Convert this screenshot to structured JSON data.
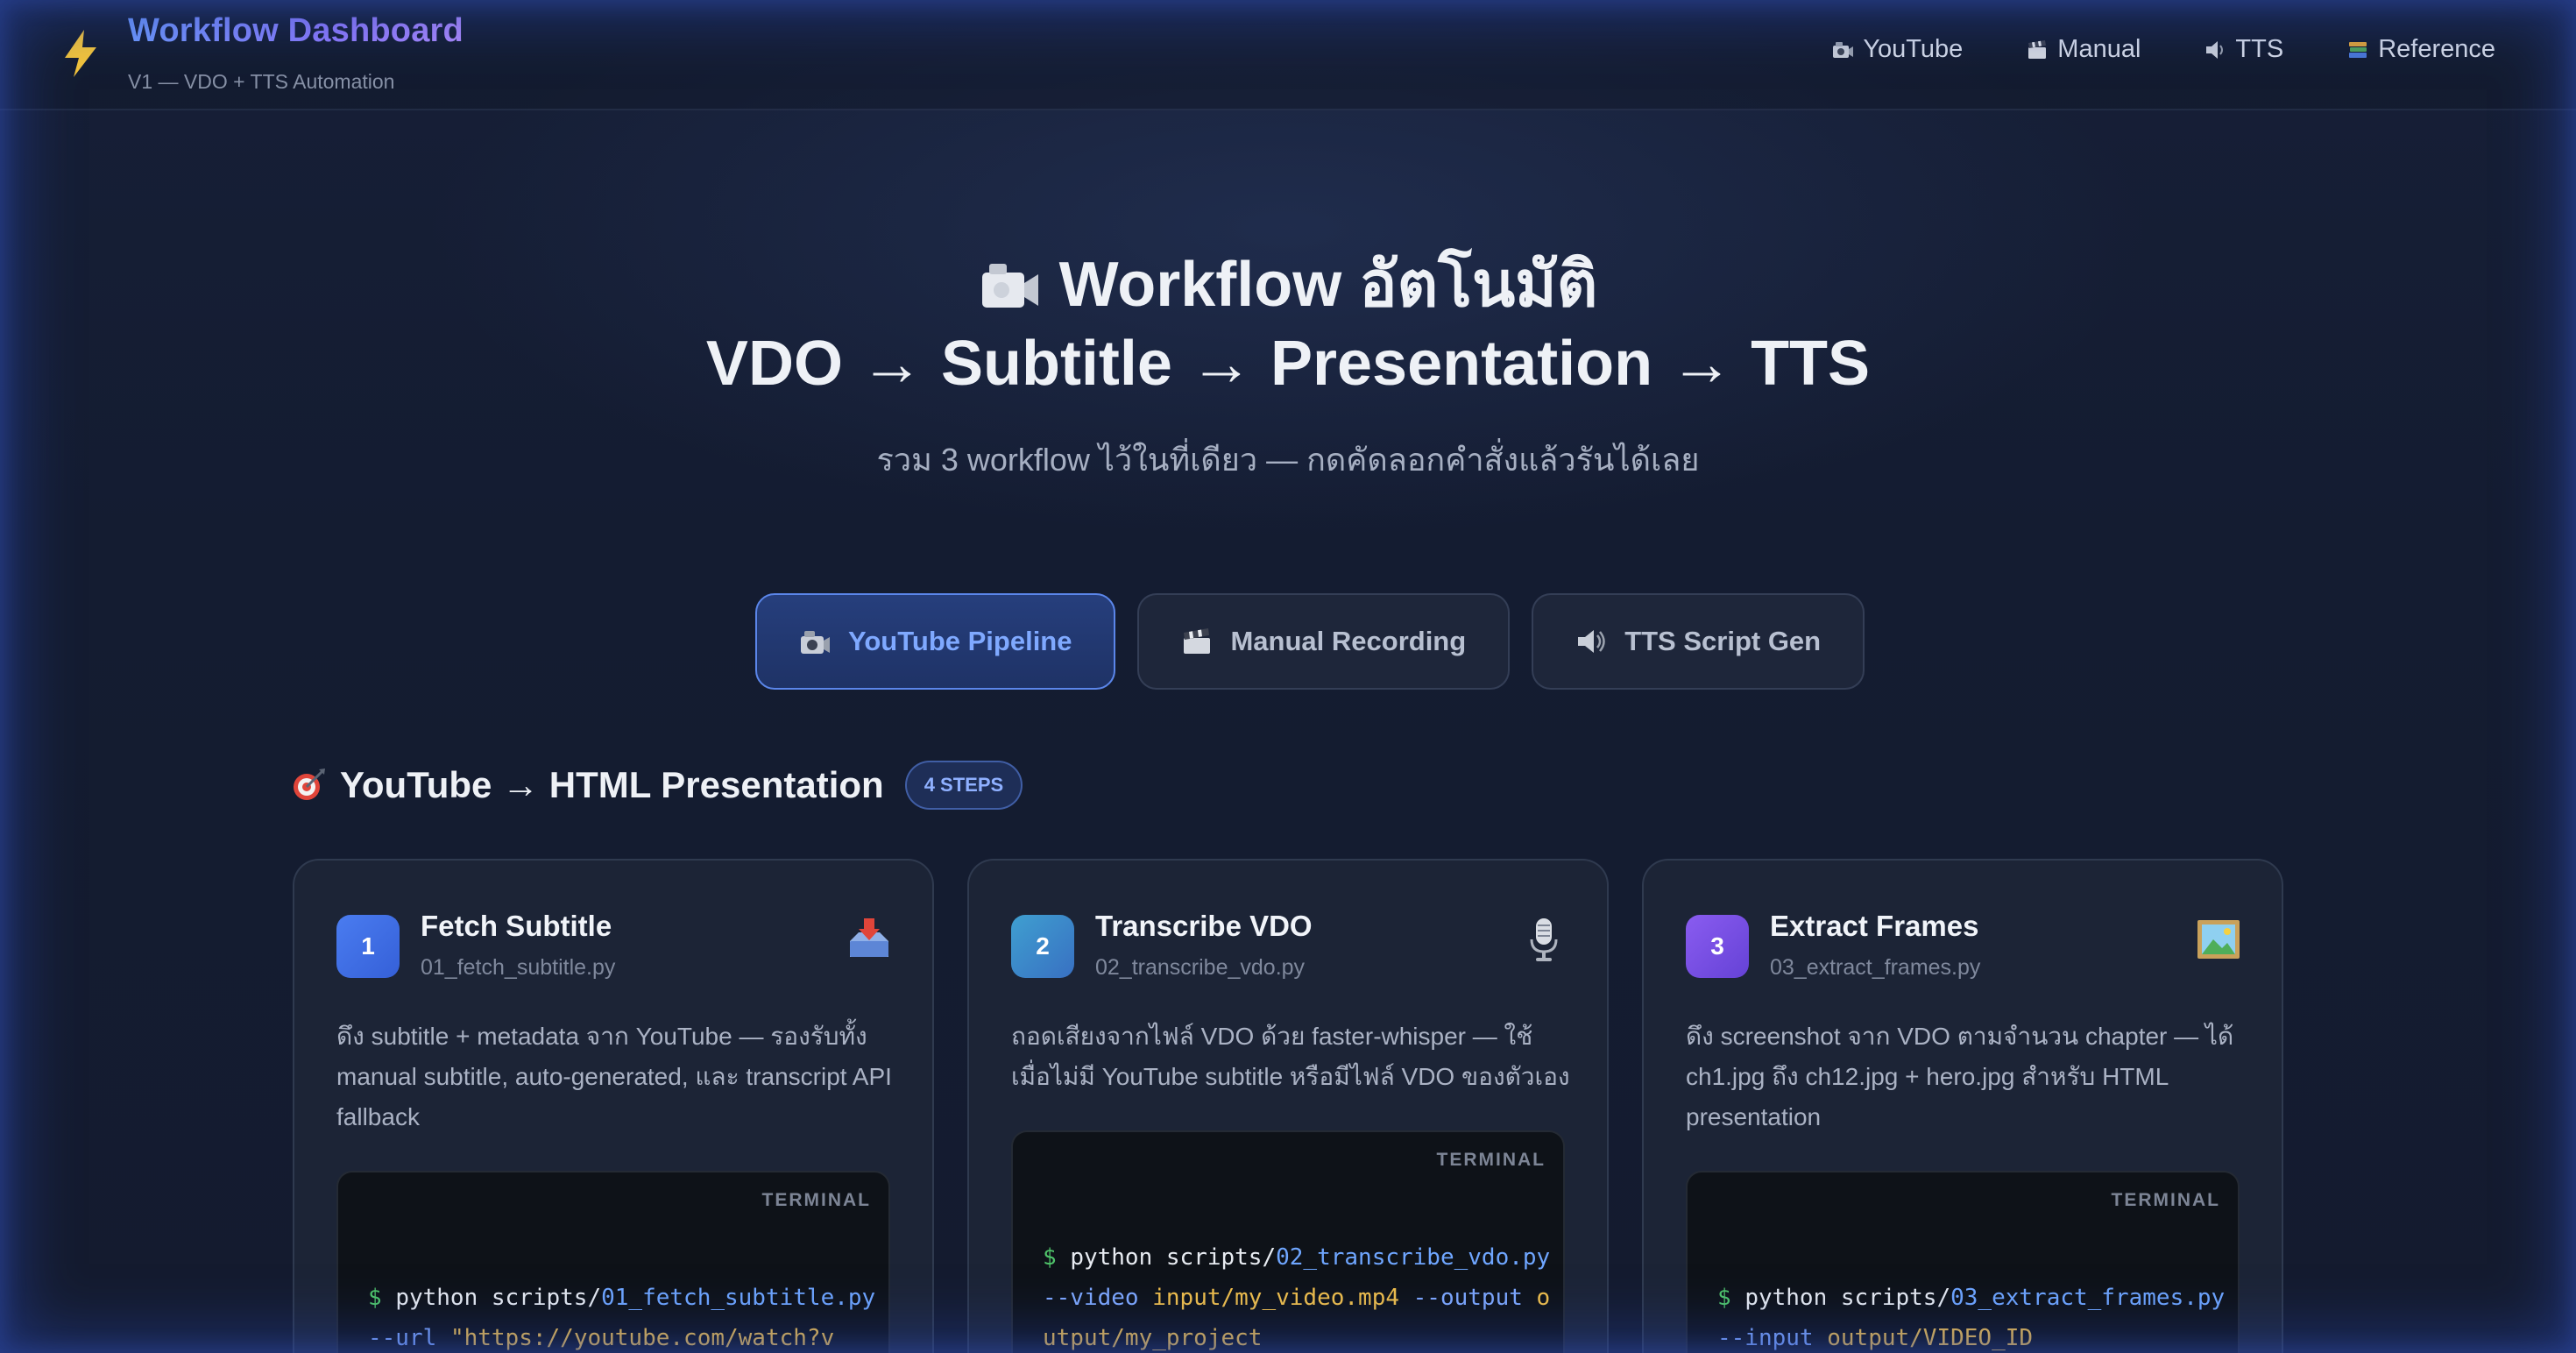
{
  "brand": {
    "title": "Workflow Dashboard",
    "subtitle": "V1 — VDO + TTS Automation",
    "icon": "lightning-icon"
  },
  "nav": [
    {
      "label": "YouTube",
      "icon": "camera-icon"
    },
    {
      "label": "Manual",
      "icon": "clapper-icon"
    },
    {
      "label": "TTS",
      "icon": "speaker-icon"
    },
    {
      "label": "Reference",
      "icon": "books-icon"
    }
  ],
  "hero": {
    "title_line1": "Workflow อัตโนมัติ",
    "title_line2": "VDO → Subtitle → Presentation → TTS",
    "subtitle": "รวม 3 workflow ไว้ในที่เดียว — กดคัดลอกคำสั่งแล้วรันได้เลย"
  },
  "tabs": [
    {
      "label": "YouTube Pipeline",
      "active": true,
      "icon": "camera-icon"
    },
    {
      "label": "Manual Recording",
      "active": false,
      "icon": "clapper-icon"
    },
    {
      "label": "TTS Script Gen",
      "active": false,
      "icon": "speaker-icon"
    }
  ],
  "section": {
    "title": "YouTube → HTML Presentation",
    "badge": "4 STEPS",
    "icon": "target-icon"
  },
  "cards": [
    {
      "num": "1",
      "title": "Fetch Subtitle",
      "file": "01_fetch_subtitle.py",
      "icon": "inbox-tray-icon",
      "desc": "ดึง subtitle + metadata จาก YouTube — รองรับทั้ง manual subtitle, auto-generated, และ transcript API fallback",
      "terminal_label": "TERMINAL",
      "cmd_prompt": "$",
      "cmd_prefix": "python scripts/",
      "cmd_script": "01_fetch_subtitle.py",
      "cmd_flag1": "--url",
      "cmd_arg1": "\"https://youtube.com/watch?v"
    },
    {
      "num": "2",
      "title": "Transcribe VDO",
      "file": "02_transcribe_vdo.py",
      "icon": "microphone-icon",
      "desc": "ถอดเสียงจากไฟล์ VDO ด้วย faster-whisper — ใช้เมื่อไม่มี YouTube subtitle หรือมีไฟล์ VDO ของตัวเอง",
      "terminal_label": "TERMINAL",
      "cmd_prompt": "$",
      "cmd_prefix": "python scripts/",
      "cmd_script": "02_transcribe_vdo.py",
      "cmd_flag1": "--video",
      "cmd_arg1": "input/my_video.mp4",
      "cmd_flag2": "--output",
      "cmd_arg2": "output/my_project"
    },
    {
      "num": "3",
      "title": "Extract Frames",
      "file": "03_extract_frames.py",
      "icon": "framed-picture-icon",
      "desc": "ดึง screenshot จาก VDO ตามจำนวน chapter — ได้ ch1.jpg ถึง ch12.jpg + hero.jpg สำหรับ HTML presentation",
      "terminal_label": "TERMINAL",
      "cmd_prompt": "$",
      "cmd_prefix": "python scripts/",
      "cmd_script": "03_extract_frames.py",
      "cmd_flag1": "--input",
      "cmd_arg1": "output/VIDEO_ID"
    }
  ],
  "colors": {
    "accent": "#7fa9ff",
    "step1": "#3f6fe6",
    "step2": "#3a86c8",
    "step3": "#7a4fe6",
    "prompt": "#4fc46a",
    "path": "#6fa6ff",
    "string": "#f2c04a"
  }
}
